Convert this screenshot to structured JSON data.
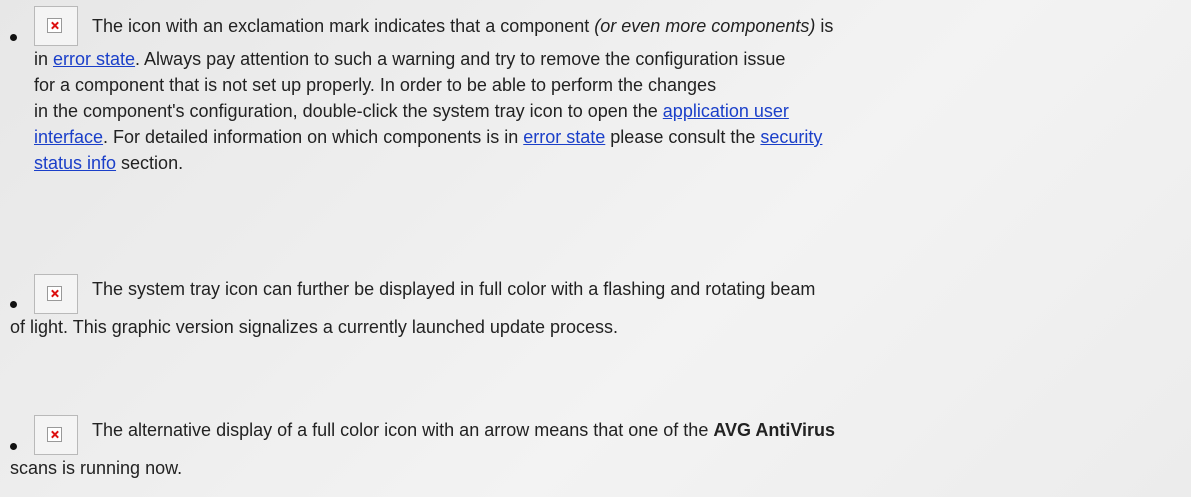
{
  "item1": {
    "icon": "broken-image-icon",
    "l1": {
      "a": "The icon with an exclamation mark indicates that a component ",
      "em": "(or even more components)",
      "b": " is"
    },
    "l2": {
      "a": "in ",
      "link": "error state",
      "b": ". Always pay attention to such a warning and try to remove the configuration issue"
    },
    "l3": "for a component that is not set up properly. In order to be able to perform the changes",
    "l4": {
      "a": "in the component's configuration, double-click the system tray icon to open the ",
      "link": "application user"
    },
    "l5": {
      "link": "interface",
      "a": ". For detailed information on which components is in ",
      "link2": "error state",
      "b": " please consult the ",
      "link3": "security"
    },
    "l6": {
      "link": "status info",
      "a": " section."
    }
  },
  "item2": {
    "icon": "broken-image-icon",
    "l1": "The system tray icon can further be displayed in full color with a flashing and rotating beam",
    "l2": "of light. This graphic version signalizes a currently launched update process."
  },
  "item3": {
    "icon": "broken-image-icon",
    "l1": {
      "a": "The alternative display of a full color icon with an arrow means that one of the ",
      "strong": "AVG AntiVirus"
    },
    "l2": "scans is running now."
  }
}
